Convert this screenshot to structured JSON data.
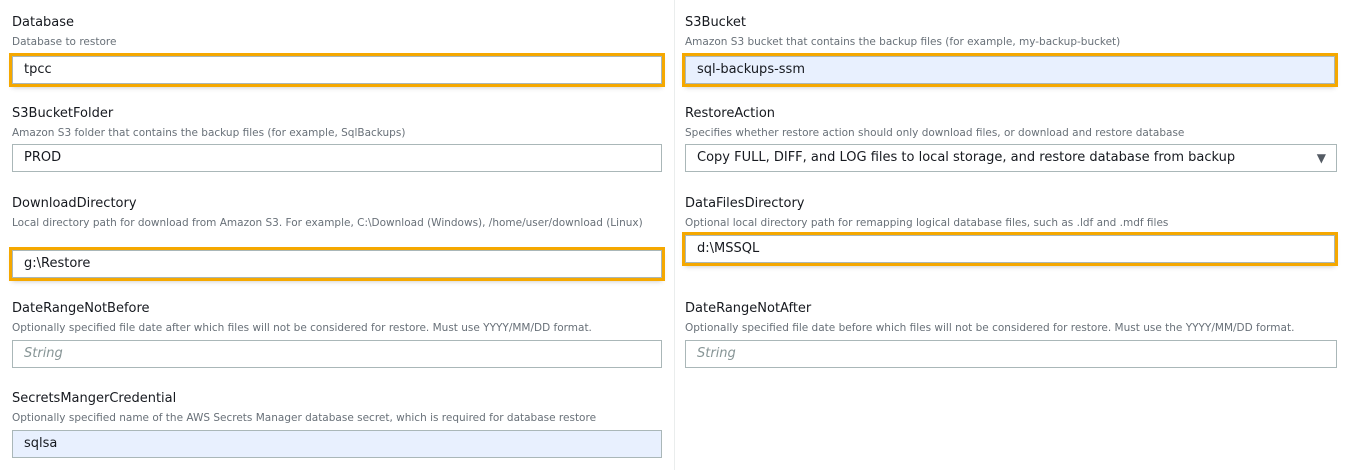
{
  "left": [
    {
      "label": "Database",
      "description": "Database to restore",
      "value": "tpcc"
    },
    {
      "label": "S3BucketFolder",
      "description": "Amazon S3 folder that contains the backup files (for example, SqlBackups)",
      "value": "PROD"
    },
    {
      "label": "DownloadDirectory",
      "description": "Local directory path for download from Amazon S3. For example, C:\\Download (Windows), /home/user/download (Linux)",
      "value": "g:\\Restore"
    },
    {
      "label": "DateRangeNotBefore",
      "description": "Optionally specified file date after which files will not be considered for restore. Must use YYYY/MM/DD format.",
      "placeholder": "String"
    },
    {
      "label": "SecretsMangerCredential",
      "description": "Optionally specified name of the AWS Secrets Manager database secret, which is required for database restore",
      "value": "sqlsa"
    }
  ],
  "right": [
    {
      "label": "S3Bucket",
      "description": "Amazon S3 bucket that contains the backup files (for example, my-backup-bucket)",
      "value": "sql-backups-ssm"
    },
    {
      "label": "RestoreAction",
      "description": "Specifies whether restore action should only download files, or download and restore database",
      "value": "Copy FULL, DIFF, and LOG files to local storage, and restore database from backup"
    },
    {
      "label": "DataFilesDirectory",
      "description": "Optional local directory path for remapping logical database files, such as .ldf and .mdf files",
      "value": "d:\\MSSQL"
    },
    {
      "label": "DateRangeNotAfter",
      "description": "Optionally specified file date before which files will not be considered for restore. Must use the YYYY/MM/DD format.",
      "placeholder": "String"
    }
  ]
}
